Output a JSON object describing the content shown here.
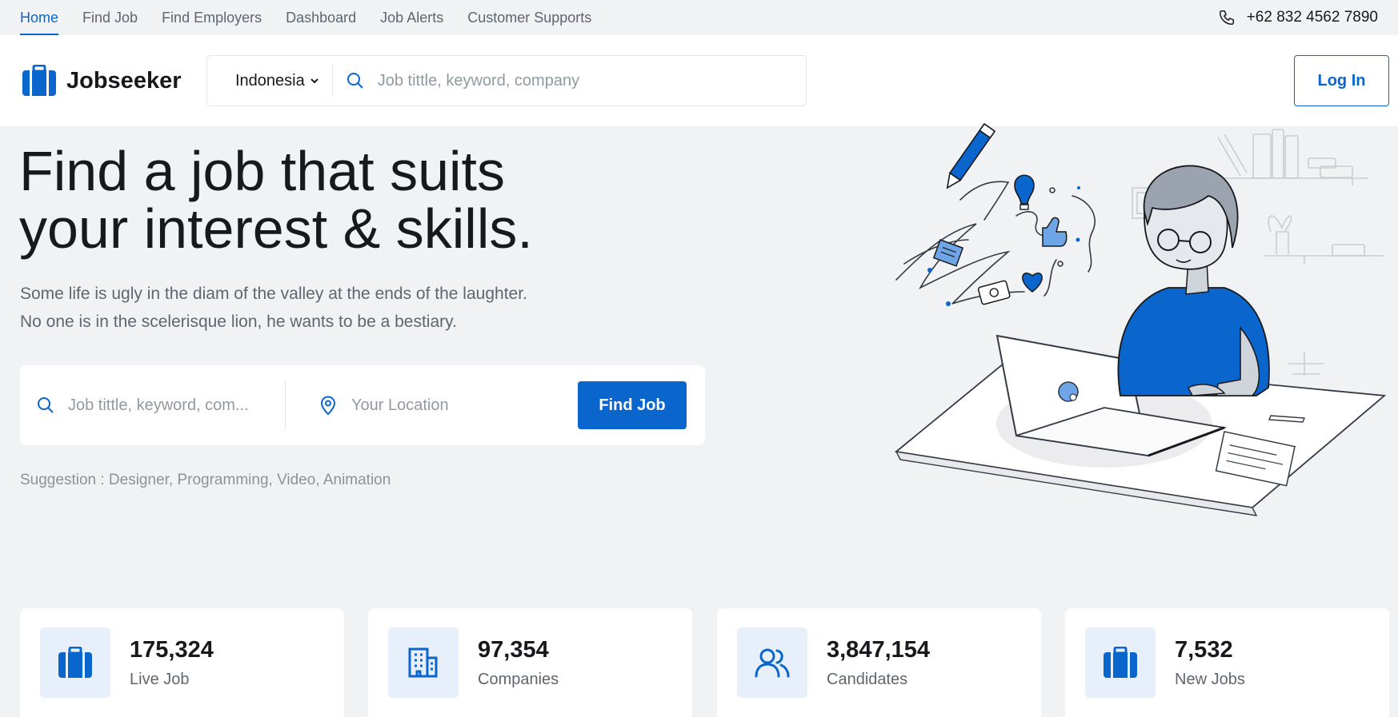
{
  "topnav": {
    "items": [
      {
        "label": "Home",
        "active": true
      },
      {
        "label": "Find Job"
      },
      {
        "label": "Find Employers"
      },
      {
        "label": "Dashboard"
      },
      {
        "label": "Job Alerts"
      },
      {
        "label": "Customer Supports"
      }
    ],
    "phone": "+62 832 4562 7890",
    "phone_icon": "phone-icon"
  },
  "header": {
    "logo_text": "Jobseeker",
    "logo_icon": "briefcase-icon",
    "country": "Indonesia",
    "search_placeholder": "Job tittle, keyword, company",
    "login_label": "Log In"
  },
  "hero": {
    "title_line1": "Find a job that suits",
    "title_line2": "your interest & skills.",
    "subtitle_line1": "Some life is ugly in the diam of the valley at the ends of the laughter.",
    "subtitle_line2": "No one is in the scelerisque lion, he wants to be a bestiary.",
    "search": {
      "keyword_placeholder": "Job tittle, keyword, com...",
      "location_placeholder": "Your Location",
      "button_label": "Find Job"
    },
    "suggestion_label": "Suggestion : ",
    "suggestion_items": "Designer, Programming, Video, Animation"
  },
  "stats": [
    {
      "value": "175,324",
      "label": "Live Job",
      "icon": "briefcase-icon"
    },
    {
      "value": "97,354",
      "label": "Companies",
      "icon": "building-icon"
    },
    {
      "value": "3,847,154",
      "label": "Candidates",
      "icon": "users-icon"
    },
    {
      "value": "7,532",
      "label": "New Jobs",
      "icon": "briefcase-icon"
    }
  ],
  "colors": {
    "primary": "#0a65cc",
    "background": "#f1f2f4",
    "text_dark": "#18191c",
    "text_gray": "#5e6670",
    "icon_bg": "#e7f0fa"
  }
}
